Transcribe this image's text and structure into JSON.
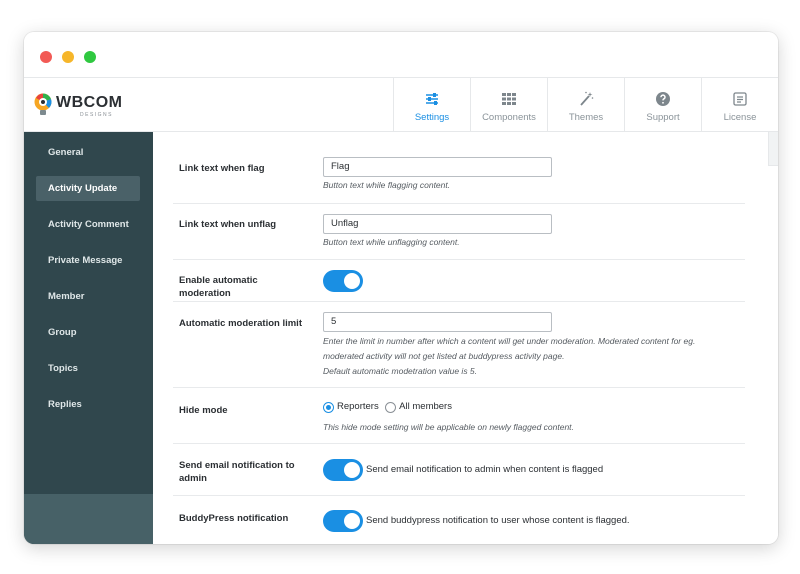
{
  "brand": {
    "name": "WBCOM",
    "sub": "DESIGNS"
  },
  "tabs": [
    {
      "label": "Settings",
      "icon": "sliders-icon",
      "active": true
    },
    {
      "label": "Components",
      "icon": "grid-icon",
      "active": false
    },
    {
      "label": "Themes",
      "icon": "magic-wand-icon",
      "active": false
    },
    {
      "label": "Support",
      "icon": "question-circle-icon",
      "active": false
    },
    {
      "label": "License",
      "icon": "license-icon",
      "active": false
    }
  ],
  "sidebar": {
    "items": [
      {
        "label": "General"
      },
      {
        "label": "Activity Update",
        "active": true
      },
      {
        "label": "Activity Comment"
      },
      {
        "label": "Private Message"
      },
      {
        "label": "Member"
      },
      {
        "label": "Group"
      },
      {
        "label": "Topics"
      },
      {
        "label": "Replies"
      }
    ]
  },
  "settings": {
    "flag_text": {
      "label": "Link text when flag",
      "value": "Flag",
      "desc": "Button text while flagging content."
    },
    "unflag_text": {
      "label": "Link text when unflag",
      "value": "Unflag",
      "desc": "Button text while unflagging content."
    },
    "auto_moderation": {
      "label": "Enable automatic moderation",
      "enabled": true
    },
    "moderation_limit": {
      "label": "Automatic moderation limit",
      "value": "5",
      "desc_line1": "Enter the limit in number after which a content will get under moderation. Moderated content for eg.",
      "desc_line2": "moderated activity will not get listed at buddypress activity page.",
      "desc_line3": "Default automatic modetration value is 5."
    },
    "hide_mode": {
      "label": "Hide mode",
      "options": [
        "Reporters",
        "All members"
      ],
      "selected": "Reporters",
      "desc": "This hide mode setting will be applicable on newly flagged content."
    },
    "email_notification": {
      "label_line1": "Send email notification to",
      "label_line2": "admin",
      "enabled": true,
      "text": "Send email notification to admin when content is flagged"
    },
    "buddypress_notification": {
      "label": "BuddyPress notification",
      "enabled": true,
      "text": "Send buddypress notification to user whose content is flagged."
    }
  },
  "colors": {
    "accent": "#1a8fe3",
    "sidebar": "#30474d",
    "sidebar_active": "#4a6168"
  }
}
